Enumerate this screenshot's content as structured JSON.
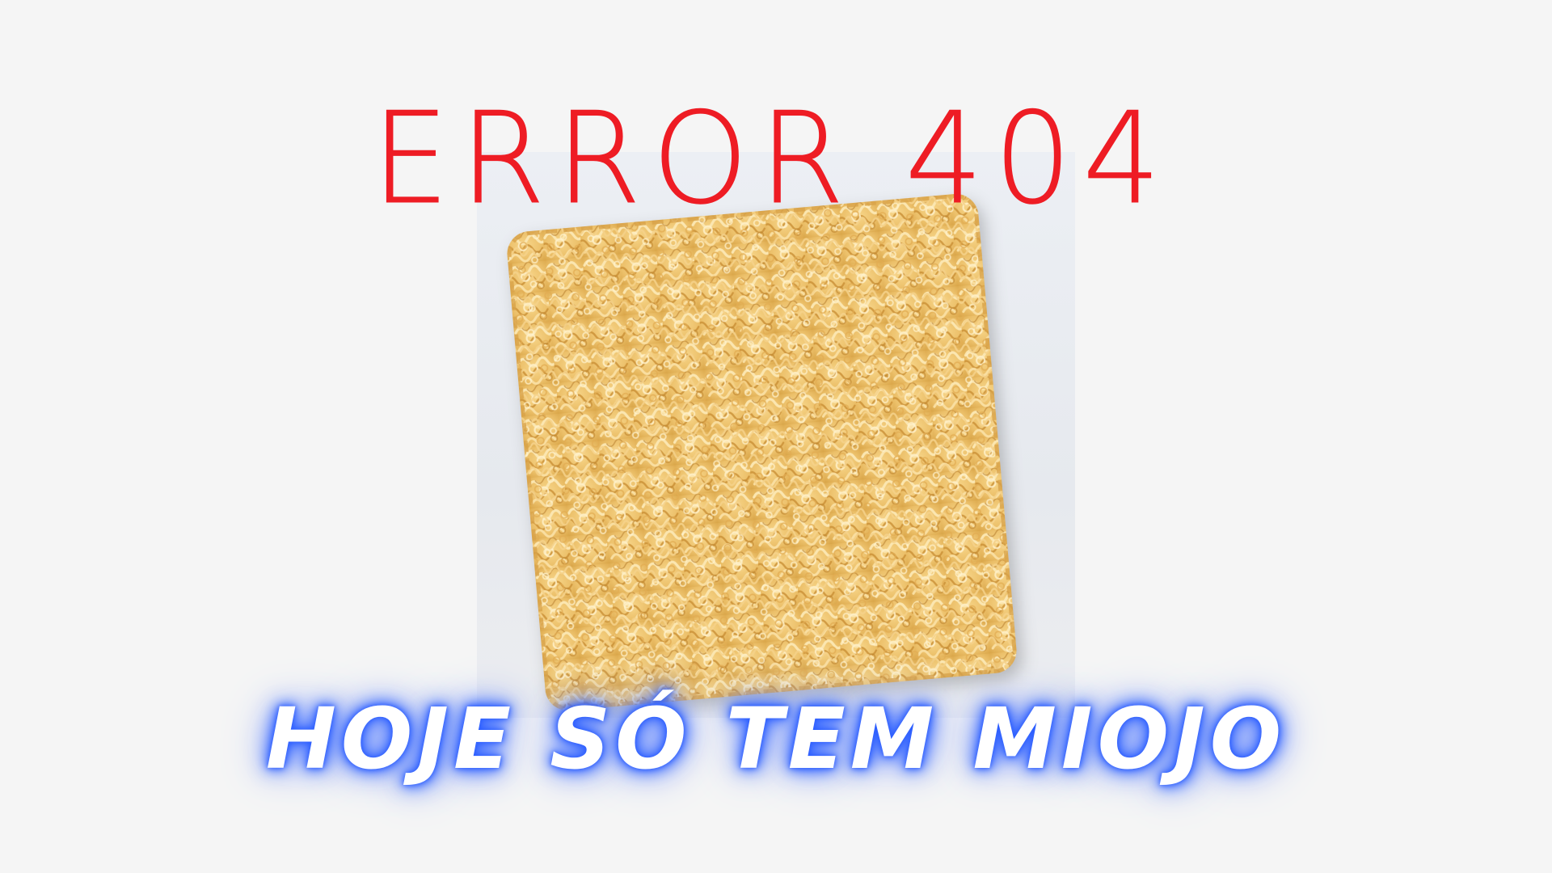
{
  "heading": {
    "error_text": "ERROR 404",
    "color": "#ee1c24"
  },
  "image": {
    "subject": "instant-noodle-block",
    "backdrop_color": "#e8ebf0"
  },
  "tagline": {
    "text": "HOJE SÓ TEM MIOJO",
    "text_color": "#ffffff",
    "glow_color": "#2a5cff"
  },
  "page": {
    "background": "#f5f5f5"
  }
}
